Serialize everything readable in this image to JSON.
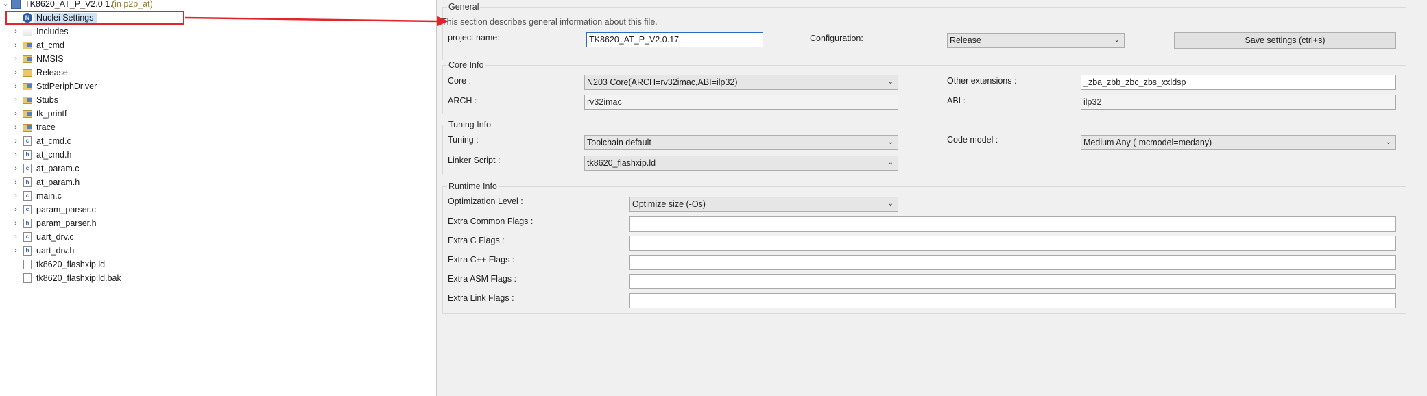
{
  "tree": {
    "project": {
      "label": "TK8620_AT_P_V2.0.17",
      "suffix": "(in p2p_at)"
    },
    "items": [
      {
        "label": "Nuclei Settings",
        "icon": "nuclei-icon"
      },
      {
        "label": "Includes",
        "icon": "includes-icon"
      },
      {
        "label": "at_cmd",
        "icon": "folder-icon"
      },
      {
        "label": "NMSIS",
        "icon": "folder-icon"
      },
      {
        "label": "Release",
        "icon": "folder-icon"
      },
      {
        "label": "StdPeriphDriver",
        "icon": "folder-icon"
      },
      {
        "label": "Stubs",
        "icon": "folder-icon"
      },
      {
        "label": "tk_printf",
        "icon": "folder-icon"
      },
      {
        "label": "trace",
        "icon": "folder-icon"
      },
      {
        "label": "at_cmd.c",
        "icon": "c-file-icon"
      },
      {
        "label": "at_cmd.h",
        "icon": "h-file-icon"
      },
      {
        "label": "at_param.c",
        "icon": "c-file-icon"
      },
      {
        "label": "at_param.h",
        "icon": "h-file-icon"
      },
      {
        "label": "main.c",
        "icon": "c-file-icon"
      },
      {
        "label": "param_parser.c",
        "icon": "c-file-icon"
      },
      {
        "label": "param_parser.h",
        "icon": "h-file-icon"
      },
      {
        "label": "uart_drv.c",
        "icon": "c-file-icon"
      },
      {
        "label": "uart_drv.h",
        "icon": "h-file-icon"
      },
      {
        "label": "tk8620_flashxip.ld",
        "icon": "file-icon"
      },
      {
        "label": "tk8620_flashxip.ld.bak",
        "icon": "file-icon"
      }
    ],
    "file_badges": {
      "c": "c",
      "h": "h"
    }
  },
  "general": {
    "title": "General",
    "description": "This section describes general information about this file.",
    "project_name_label": "project name:",
    "project_name_value": "TK8620_AT_P_V2.0.17",
    "configuration_label": "Configuration:",
    "configuration_value": "Release",
    "save_button": "Save settings (ctrl+s)"
  },
  "core_info": {
    "title": "Core Info",
    "core_label": "Core :",
    "core_value": "N203 Core(ARCH=rv32imac,ABI=ilp32)",
    "other_ext_label": "Other extensions :",
    "other_ext_value": "_zba_zbb_zbc_zbs_xxldsp",
    "arch_label": "ARCH :",
    "arch_value": "rv32imac",
    "abi_label": "ABI :",
    "abi_value": "ilp32"
  },
  "tuning_info": {
    "title": "Tuning Info",
    "tuning_label": "Tuning :",
    "tuning_value": "Toolchain default",
    "code_model_label": "Code model :",
    "code_model_value": "Medium Any (-mcmodel=medany)",
    "linker_label": "Linker Script :",
    "linker_value": "tk8620_flashxip.ld"
  },
  "runtime_info": {
    "title": "Runtime Info",
    "opt_label": "Optimization Level :",
    "opt_value": "Optimize size (-Os)",
    "flags": [
      {
        "label": "Extra Common Flags :",
        "value": ""
      },
      {
        "label": "Extra C Flags :",
        "value": ""
      },
      {
        "label": "Extra C++ Flags :",
        "value": ""
      },
      {
        "label": "Extra ASM Flags :",
        "value": ""
      },
      {
        "label": "Extra Link Flags :",
        "value": ""
      }
    ]
  },
  "colors": {
    "highlight": "#e0262b",
    "focus": "#2a6cc8"
  }
}
